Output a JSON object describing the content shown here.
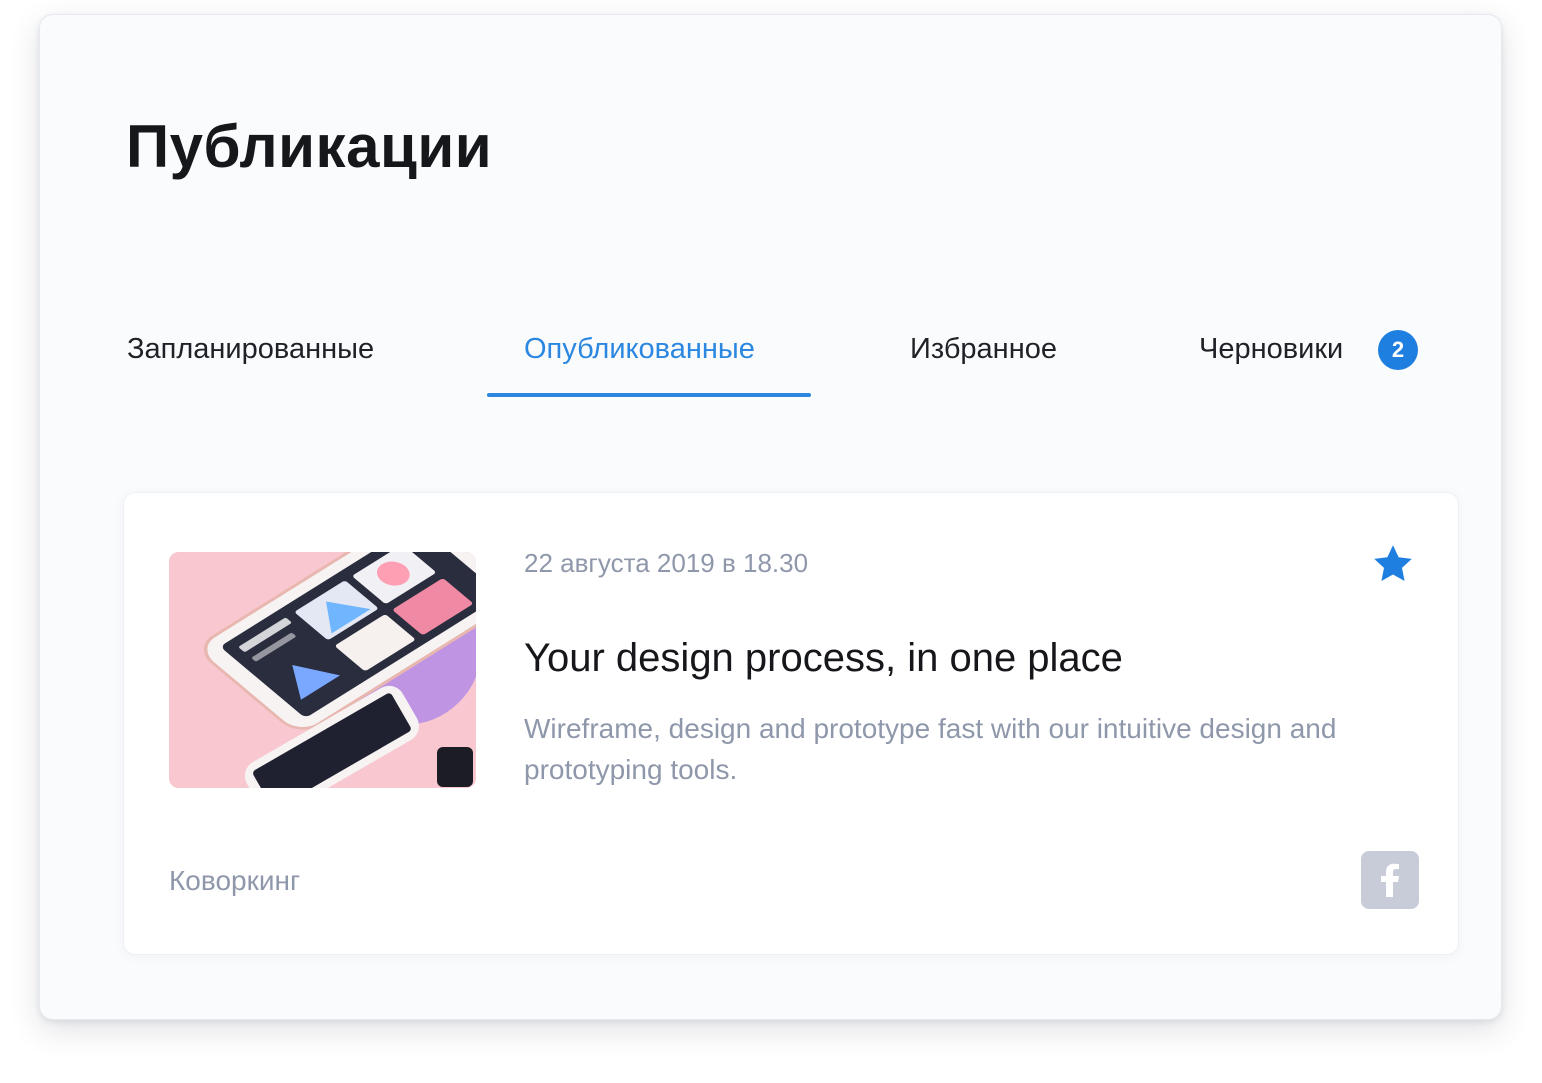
{
  "page": {
    "title": "Публикации"
  },
  "tabs": [
    {
      "label": "Запланированные",
      "active": false
    },
    {
      "label": "Опубликованные",
      "active": true
    },
    {
      "label": "Избранное",
      "active": false
    },
    {
      "label": "Черновики",
      "active": false,
      "badge": "2"
    }
  ],
  "post": {
    "date": "22 августа 2019 в 18.30",
    "title": "Your design process, in one place",
    "description": "Wireframe, design and prototype fast with our intuitive design and prototyping tools.",
    "category": "Коворкинг",
    "starred": true,
    "thumbnail_icon": "phone-mockup-image",
    "share_icon": "facebook-icon"
  },
  "colors": {
    "accent": "#2b87e0",
    "badge": "#1f7fe0",
    "muted_text": "#8f97ab",
    "panel_bg": "#fafbfd",
    "thumb_bg": "#f8c7cf",
    "facebook_button": "#c7ccd8"
  }
}
